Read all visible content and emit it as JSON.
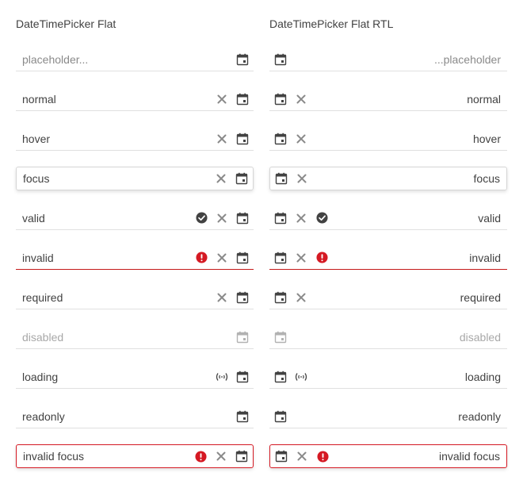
{
  "ltr": {
    "title": "DateTimePicker Flat",
    "fields": [
      {
        "text": "placeholder...",
        "state": "placeholder",
        "icons": []
      },
      {
        "text": "normal",
        "state": "normal",
        "icons": [
          "clear"
        ]
      },
      {
        "text": "hover",
        "state": "hover",
        "icons": [
          "clear"
        ]
      },
      {
        "text": "focus",
        "state": "focus",
        "icons": [
          "clear"
        ]
      },
      {
        "text": "valid",
        "state": "valid",
        "icons": [
          "valid",
          "clear"
        ]
      },
      {
        "text": "invalid",
        "state": "invalid",
        "icons": [
          "invalid",
          "clear"
        ]
      },
      {
        "text": "required",
        "state": "required",
        "icons": [
          "clear"
        ]
      },
      {
        "text": "disabled",
        "state": "disabled",
        "icons": []
      },
      {
        "text": "loading",
        "state": "loading",
        "icons": [
          "loading"
        ]
      },
      {
        "text": "readonly",
        "state": "readonly",
        "icons": []
      },
      {
        "text": "invalid focus",
        "state": "invalid-focus",
        "icons": [
          "invalid",
          "clear"
        ]
      }
    ]
  },
  "rtl": {
    "title": "DateTimePicker Flat RTL",
    "fields": [
      {
        "text": "...placeholder",
        "state": "placeholder",
        "icons": []
      },
      {
        "text": "normal",
        "state": "normal",
        "icons": [
          "clear"
        ]
      },
      {
        "text": "hover",
        "state": "hover",
        "icons": [
          "clear"
        ]
      },
      {
        "text": "focus",
        "state": "focus",
        "icons": [
          "clear"
        ]
      },
      {
        "text": "valid",
        "state": "valid",
        "icons": [
          "valid",
          "clear"
        ]
      },
      {
        "text": "invalid",
        "state": "invalid",
        "icons": [
          "invalid",
          "clear"
        ]
      },
      {
        "text": "required",
        "state": "required",
        "icons": [
          "clear"
        ]
      },
      {
        "text": "disabled",
        "state": "disabled",
        "icons": []
      },
      {
        "text": "loading",
        "state": "loading",
        "icons": [
          "loading"
        ]
      },
      {
        "text": "readonly",
        "state": "readonly",
        "icons": []
      },
      {
        "text": "invalid focus",
        "state": "invalid-focus",
        "icons": [
          "invalid",
          "clear"
        ]
      }
    ]
  },
  "colors": {
    "text": "#424242",
    "placeholder": "#8a8a8a",
    "border": "#e0e0e0",
    "invalid": "#c41a1a",
    "error_icon": "#d51923",
    "valid_icon": "#424242"
  }
}
